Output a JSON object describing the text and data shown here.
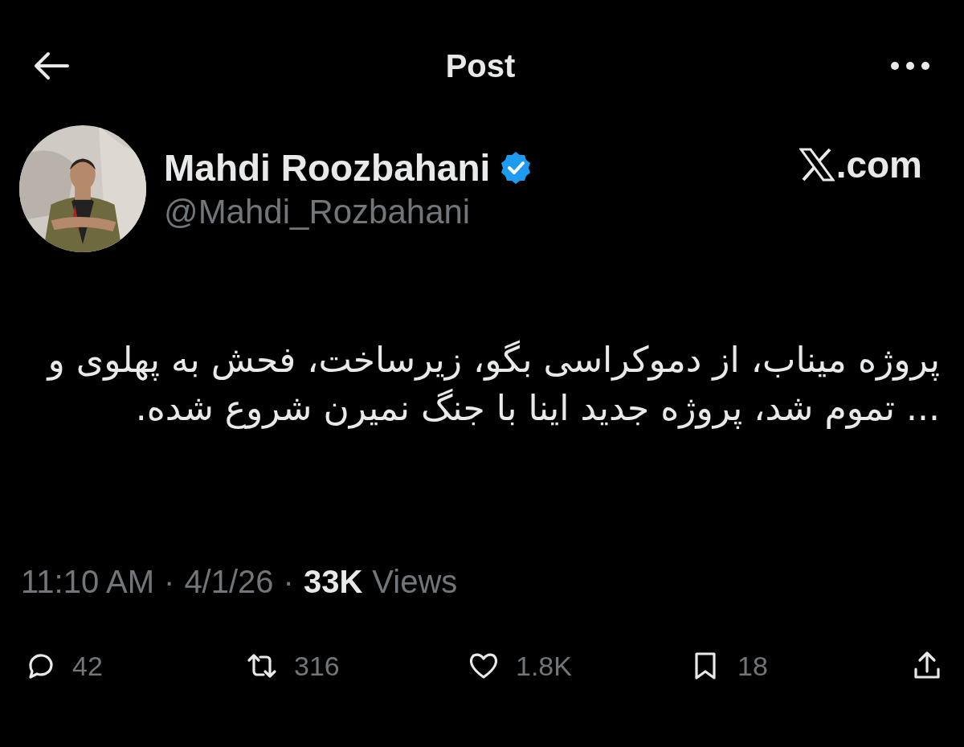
{
  "header": {
    "title": "Post"
  },
  "author": {
    "name": "Mahdi Roozbahani",
    "verified": true,
    "handle": "@Mahdi_Rozbahani"
  },
  "source": ".com",
  "body": "پروژه میناب، از دموکراسی بگو، زیرساخت، فحش به پهلوی و ... تموم شد، پروژه جدید اینا با جنگ نمیرن شروع شده.",
  "meta": {
    "time": "11:10 AM",
    "separator_1": "·",
    "date": "4/1/26",
    "separator_2": "·",
    "views_count": "33K",
    "views_label": "Views"
  },
  "actions": [
    {
      "kind": "reply",
      "count": "42"
    },
    {
      "kind": "repost",
      "count": "316"
    },
    {
      "kind": "like",
      "count": "1.8K"
    },
    {
      "kind": "bookmark",
      "count": "18"
    },
    {
      "kind": "share"
    }
  ]
}
